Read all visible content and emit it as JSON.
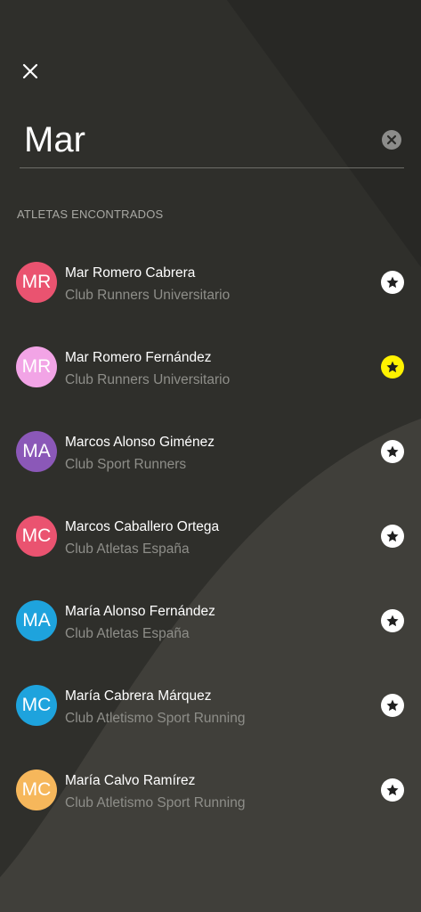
{
  "search": {
    "value": "Mar"
  },
  "section_title": "ATLETAS ENCONTRADOS",
  "athletes": [
    {
      "initials": "MR",
      "name": "Mar Romero Cabrera",
      "club": "Club Runners Universitario",
      "avatar_color": "#ea5370",
      "favorite": false
    },
    {
      "initials": "MR",
      "name": "Mar Romero Fernández",
      "club": "Club Runners Universitario",
      "avatar_color": "#f2a4e6",
      "favorite": true
    },
    {
      "initials": "MA",
      "name": "Marcos Alonso Giménez",
      "club": "Club Sport Runners",
      "avatar_color": "#8b58b8",
      "favorite": false
    },
    {
      "initials": "MC",
      "name": "Marcos Caballero Ortega",
      "club": "Club Atletas España",
      "avatar_color": "#ea5370",
      "favorite": false
    },
    {
      "initials": "MA",
      "name": "María Alonso Fernández",
      "club": "Club Atletas España",
      "avatar_color": "#1ea3dd",
      "favorite": false
    },
    {
      "initials": "MC",
      "name": "María Cabrera Márquez",
      "club": "Club Atletismo Sport Running",
      "avatar_color": "#1ea3dd",
      "favorite": false
    },
    {
      "initials": "MC",
      "name": "María Calvo Ramírez",
      "club": "Club Atletismo Sport Running",
      "avatar_color": "#f6b75b",
      "favorite": false
    }
  ],
  "colors": {
    "favorite_active": "#fff200",
    "favorite_inactive": "#ffffff",
    "star": "#1f1f1f",
    "caret": "#2f7fe0"
  },
  "icons": {
    "close": "close-icon",
    "clear": "clear-icon",
    "favorite": "star-icon"
  }
}
